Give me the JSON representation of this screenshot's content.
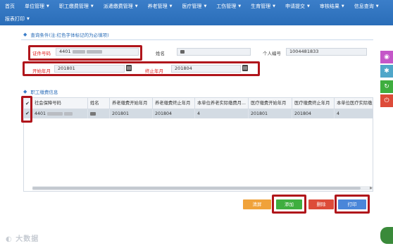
{
  "nav": {
    "row1": [
      {
        "label": "首页",
        "caret": false
      },
      {
        "label": "单位管理",
        "caret": true
      },
      {
        "label": "职工缴费管理",
        "caret": true
      },
      {
        "label": "派遣缴费管理",
        "caret": true
      },
      {
        "label": "养老管理",
        "caret": true
      },
      {
        "label": "医疗管理",
        "caret": true
      },
      {
        "label": "工伤管理",
        "caret": true
      },
      {
        "label": "生育管理",
        "caret": true
      },
      {
        "label": "申请提交",
        "caret": true
      },
      {
        "label": "审核结果",
        "caret": true
      },
      {
        "label": "信息查询",
        "caret": true
      }
    ],
    "row2": [
      {
        "label": "报表打印",
        "caret": true
      }
    ]
  },
  "query": {
    "title": "查询条件(注:红色字体标记的为必填项)",
    "id_label": "证件号码",
    "id_value": "4401",
    "name_label": "姓名",
    "name_value": "",
    "personal_no_label": "个人编号",
    "personal_no_value": "1004481833",
    "start_label": "开始年月",
    "start_value": "201801",
    "end_label": "终止年月",
    "end_value": "201804"
  },
  "table": {
    "title": "职工缴费信息",
    "headers": [
      "社会保障号码",
      "姓名",
      "养老缴费开始年月",
      "养老缴费终止年月",
      "本单位养老实际缴费月...",
      "医疗缴费开始年月",
      "医疗缴费终止年月",
      "本单位医疗实际缴费..."
    ],
    "rows": [
      [
        "4401",
        "",
        "201801",
        "201804",
        "4",
        "201801",
        "201804",
        "4"
      ]
    ]
  },
  "buttons": {
    "clear": "清屏",
    "add": "添加",
    "delete": "删除",
    "print": "打印"
  },
  "watermark": "大数据"
}
